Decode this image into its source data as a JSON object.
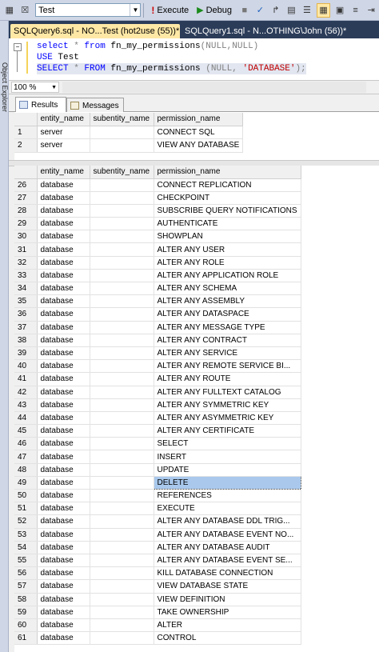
{
  "toolbar": {
    "database": "Test",
    "execute_label": "Execute",
    "debug_label": "Debug"
  },
  "sidebar": {
    "label": "Object Explorer"
  },
  "tabs": [
    {
      "label": "SQLQuery6.sql - NO...Test (hot2use (55))*",
      "active": true
    },
    {
      "label": "SQLQuery1.sql - N...OTHING\\John (56))*",
      "active": false
    }
  ],
  "editor": {
    "lines": [
      {
        "kw1": "select",
        "op": " * ",
        "kw2": "from",
        "fn": " fn_my_permissions",
        "args": "(NULL,NULL)"
      },
      {
        "kw1": "USE",
        "rest": " Test"
      },
      {
        "kw1": "SELECT",
        "op": " * ",
        "kw2": "FROM",
        "fn": " fn_my_permissions ",
        "open": "(NULL, ",
        "str": "'DATABASE'",
        "close": ");"
      }
    ]
  },
  "zoom": "100 %",
  "result_tabs": {
    "results": "Results",
    "messages": "Messages"
  },
  "grid1": {
    "columns": [
      "",
      "entity_name",
      "subentity_name",
      "permission_name"
    ],
    "rows": [
      [
        "1",
        "server",
        "",
        "CONNECT SQL"
      ],
      [
        "2",
        "server",
        "",
        "VIEW ANY DATABASE"
      ]
    ]
  },
  "grid2": {
    "columns": [
      "",
      "entity_name",
      "subentity_name",
      "permission_name"
    ],
    "rows": [
      [
        "26",
        "database",
        "",
        "CONNECT REPLICATION"
      ],
      [
        "27",
        "database",
        "",
        "CHECKPOINT"
      ],
      [
        "28",
        "database",
        "",
        "SUBSCRIBE QUERY NOTIFICATIONS"
      ],
      [
        "29",
        "database",
        "",
        "AUTHENTICATE"
      ],
      [
        "30",
        "database",
        "",
        "SHOWPLAN"
      ],
      [
        "31",
        "database",
        "",
        "ALTER ANY USER"
      ],
      [
        "32",
        "database",
        "",
        "ALTER ANY ROLE"
      ],
      [
        "33",
        "database",
        "",
        "ALTER ANY APPLICATION ROLE"
      ],
      [
        "34",
        "database",
        "",
        "ALTER ANY SCHEMA"
      ],
      [
        "35",
        "database",
        "",
        "ALTER ANY ASSEMBLY"
      ],
      [
        "36",
        "database",
        "",
        "ALTER ANY DATASPACE"
      ],
      [
        "37",
        "database",
        "",
        "ALTER ANY MESSAGE TYPE"
      ],
      [
        "38",
        "database",
        "",
        "ALTER ANY CONTRACT"
      ],
      [
        "39",
        "database",
        "",
        "ALTER ANY SERVICE"
      ],
      [
        "40",
        "database",
        "",
        "ALTER ANY REMOTE SERVICE BI..."
      ],
      [
        "41",
        "database",
        "",
        "ALTER ANY ROUTE"
      ],
      [
        "42",
        "database",
        "",
        "ALTER ANY FULLTEXT CATALOG"
      ],
      [
        "43",
        "database",
        "",
        "ALTER ANY SYMMETRIC KEY"
      ],
      [
        "44",
        "database",
        "",
        "ALTER ANY ASYMMETRIC KEY"
      ],
      [
        "45",
        "database",
        "",
        "ALTER ANY CERTIFICATE"
      ],
      [
        "46",
        "database",
        "",
        "SELECT"
      ],
      [
        "47",
        "database",
        "",
        "INSERT"
      ],
      [
        "48",
        "database",
        "",
        "UPDATE"
      ],
      [
        "49",
        "database",
        "",
        "DELETE"
      ],
      [
        "50",
        "database",
        "",
        "REFERENCES"
      ],
      [
        "51",
        "database",
        "",
        "EXECUTE"
      ],
      [
        "52",
        "database",
        "",
        "ALTER ANY DATABASE DDL TRIG..."
      ],
      [
        "53",
        "database",
        "",
        "ALTER ANY DATABASE EVENT NO..."
      ],
      [
        "54",
        "database",
        "",
        "ALTER ANY DATABASE AUDIT"
      ],
      [
        "55",
        "database",
        "",
        "ALTER ANY DATABASE EVENT SE..."
      ],
      [
        "56",
        "database",
        "",
        "KILL DATABASE CONNECTION"
      ],
      [
        "57",
        "database",
        "",
        "VIEW DATABASE STATE"
      ],
      [
        "58",
        "database",
        "",
        "VIEW DEFINITION"
      ],
      [
        "59",
        "database",
        "",
        "TAKE OWNERSHIP"
      ],
      [
        "60",
        "database",
        "",
        "ALTER"
      ],
      [
        "61",
        "database",
        "",
        "CONTROL"
      ]
    ],
    "selected_row": "49"
  },
  "colors": {
    "active_tab": "#ffe8a6",
    "tab_bar": "#2b3c59",
    "keyword": "#0000ff",
    "string": "#c00000",
    "selected_cell": "#a9c8ec"
  }
}
